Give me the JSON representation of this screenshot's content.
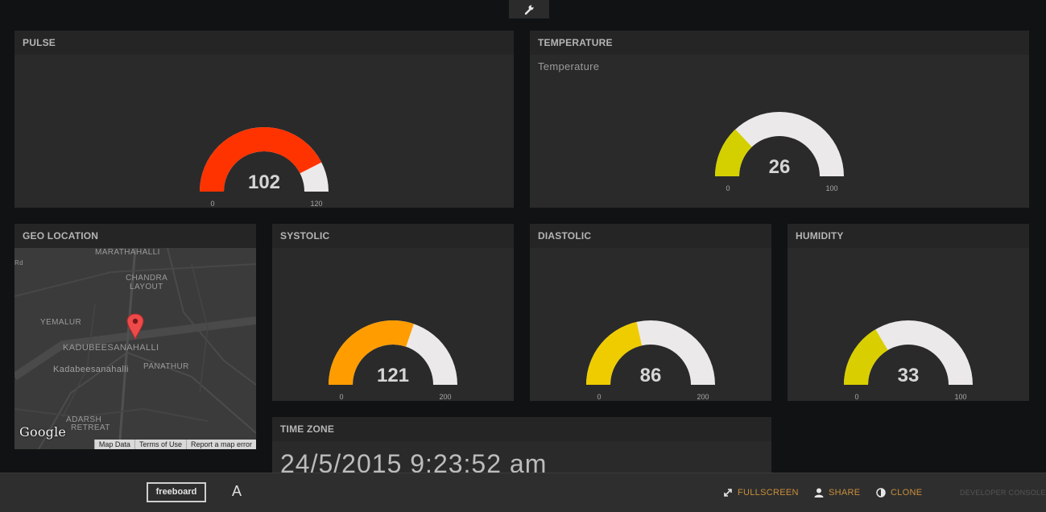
{
  "toolbar": {
    "icon": "wrench-icon"
  },
  "panes": {
    "pulse": {
      "title": "PULSE",
      "value": 102,
      "min": 0,
      "max": 120,
      "color": "#ff3300"
    },
    "temperature": {
      "title": "TEMPERATURE",
      "subtitle": "Temperature",
      "value": 26,
      "min": 0,
      "max": 100,
      "color": "#d4d000"
    },
    "systolic": {
      "title": "SYSTOLIC",
      "value": 121,
      "min": 0,
      "max": 200,
      "color": "#ff9d00"
    },
    "diastolic": {
      "title": "DIASTOLIC",
      "value": 86,
      "min": 0,
      "max": 200,
      "color": "#eecc00"
    },
    "humidity": {
      "title": "HUMIDITY",
      "value": 33,
      "min": 0,
      "max": 100,
      "color": "#d9cf00"
    },
    "geo": {
      "title": "GEO LOCATION",
      "labels": [
        "MARATHAHALLI",
        "CHANDRA",
        "LAYOUT",
        "YEMALUR",
        "KADUBEESANAHALLI",
        "Kadabeesanahalli",
        "PANATHUR",
        "ADARSH",
        "RETREAT",
        "Rd"
      ],
      "logo": "Google",
      "footer": [
        "Map Data",
        "Terms of Use",
        "Report a map error"
      ]
    },
    "timezone": {
      "title": "TIME ZONE",
      "value": "24/5/2015 9:23:52 am"
    }
  },
  "gauge_track_color": "#ece9ea",
  "footer": {
    "brand": "freeboard",
    "font_toggle": "A",
    "fullscreen": "FULLSCREEN",
    "share": "SHARE",
    "clone": "CLONE",
    "developer_console": "DEVELOPER CONSOLE"
  }
}
